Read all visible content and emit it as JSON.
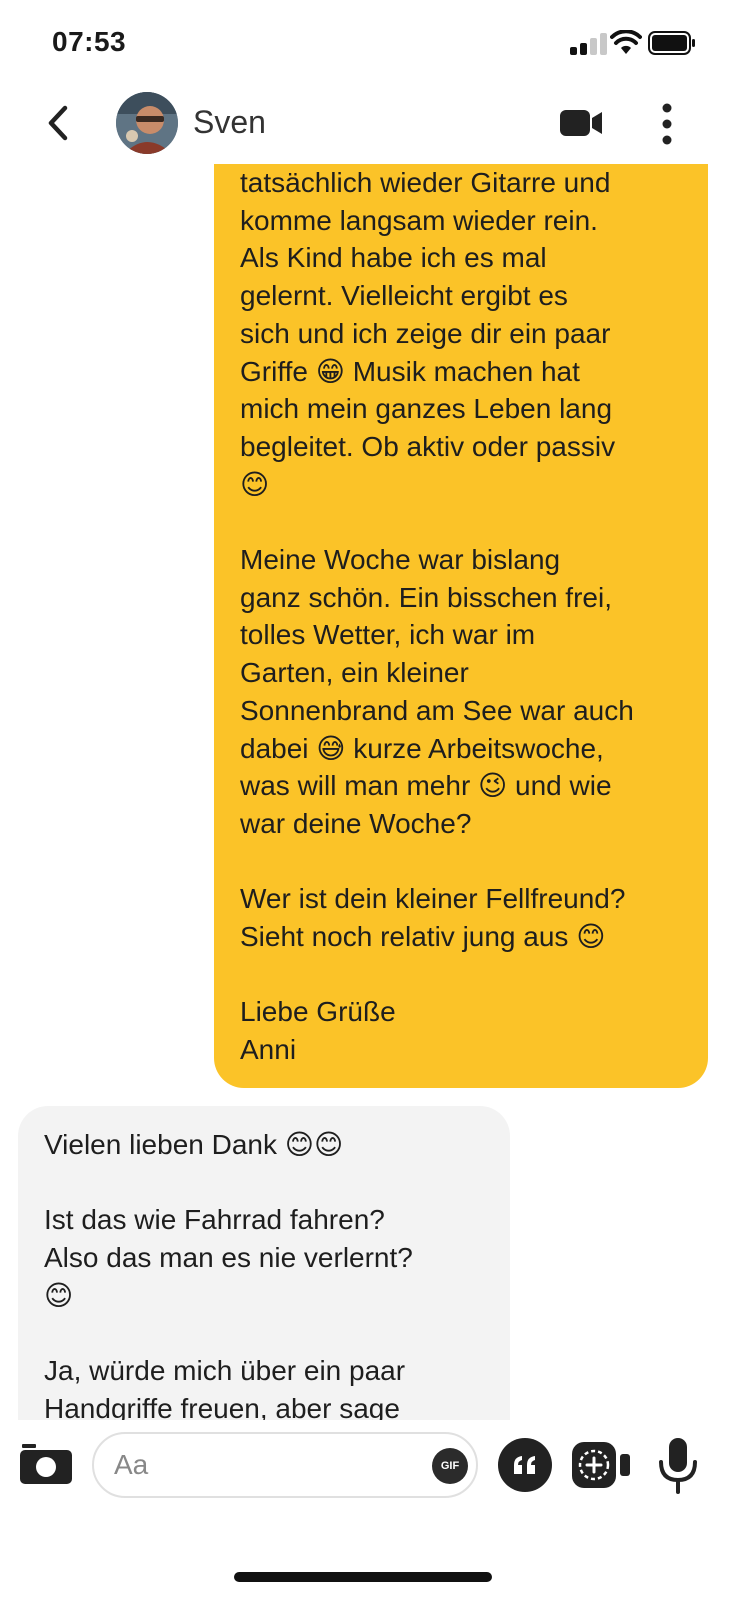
{
  "status_bar": {
    "time": "07:53",
    "icons": [
      "signal-icon",
      "wifi-icon",
      "battery-icon"
    ]
  },
  "header": {
    "back_icon": "chevron-left-icon",
    "contact_name": "Sven",
    "video_icon": "video-camera-icon",
    "more_icon": "vertical-dots-icon"
  },
  "messages": [
    {
      "direction": "outgoing",
      "text": "tatsächlich wieder Gitarre und\nkomme langsam wieder rein.\nAls Kind habe ich es mal\ngelernt. Vielleicht ergibt es\nsich und ich zeige dir ein paar\nGriffe 😁 Musik machen hat\nmich mein ganzes Leben lang\nbegleitet. Ob aktiv oder passiv\n😊\n\nMeine Woche war bislang\nganz schön. Ein bisschen frei,\ntolles Wetter, ich war im\nGarten, ein kleiner\nSonnenbrand am See war auch\ndabei 😅 kurze Arbeitswoche,\nwas will man mehr 😉 und wie\nwar deine Woche?\n\nWer ist dein kleiner Fellfreund?\nSieht noch relativ jung aus 😊\n\nLiebe Grüße\nAnni"
    },
    {
      "direction": "incoming",
      "text": "Vielen lieben Dank 😊😊\n\nIst das wie Fahrrad fahren?\nAlso das man es nie verlernt?\n😊\n\nJa, würde mich über ein paar\nHandgriffe freuen, aber sage"
    }
  ],
  "input_bar": {
    "camera_icon": "camera-icon",
    "placeholder": "Aa",
    "gif_label": "GIF",
    "quote_icon": "quote-icon",
    "sticker_icon": "sticker-video-icon",
    "mic_icon": "microphone-icon"
  },
  "colors": {
    "outgoing_bubble": "#fbc328",
    "incoming_bubble": "#f3f3f3"
  }
}
